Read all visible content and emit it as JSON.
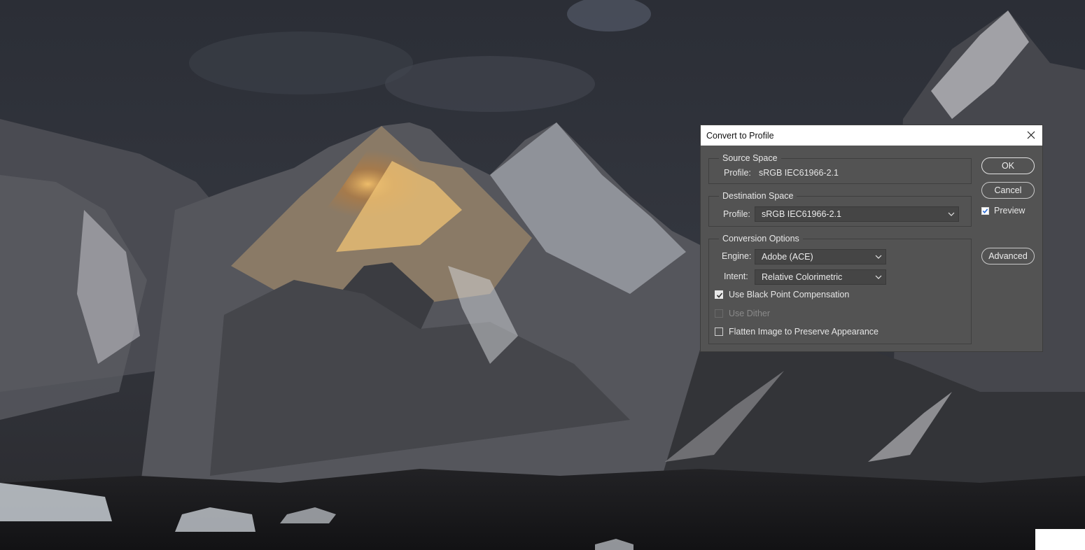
{
  "dialog": {
    "title": "Convert to Profile",
    "source": {
      "group_label": "Source Space",
      "profile_label": "Profile:",
      "profile_value": "sRGB IEC61966-2.1"
    },
    "destination": {
      "group_label": "Destination Space",
      "profile_label": "Profile:",
      "profile_value": "sRGB IEC61966-2.1"
    },
    "conversion": {
      "group_label": "Conversion Options",
      "engine_label": "Engine:",
      "engine_value": "Adobe (ACE)",
      "intent_label": "Intent:",
      "intent_value": "Relative Colorimetric",
      "black_point_label": "Use Black Point Compensation",
      "black_point_checked": true,
      "dither_label": "Use Dither",
      "dither_enabled": false,
      "flatten_label": "Flatten Image to Preserve Appearance",
      "flatten_checked": false
    },
    "buttons": {
      "ok": "OK",
      "cancel": "Cancel",
      "advanced": "Advanced"
    },
    "preview": {
      "label": "Preview",
      "checked": true
    }
  },
  "colors": {
    "dialog_bg": "#535353",
    "checkbox_accent": "#2f6fd6"
  },
  "icons": {
    "close": "close-icon",
    "dropdown": "chevron-down-icon",
    "check": "checkmark-icon"
  }
}
